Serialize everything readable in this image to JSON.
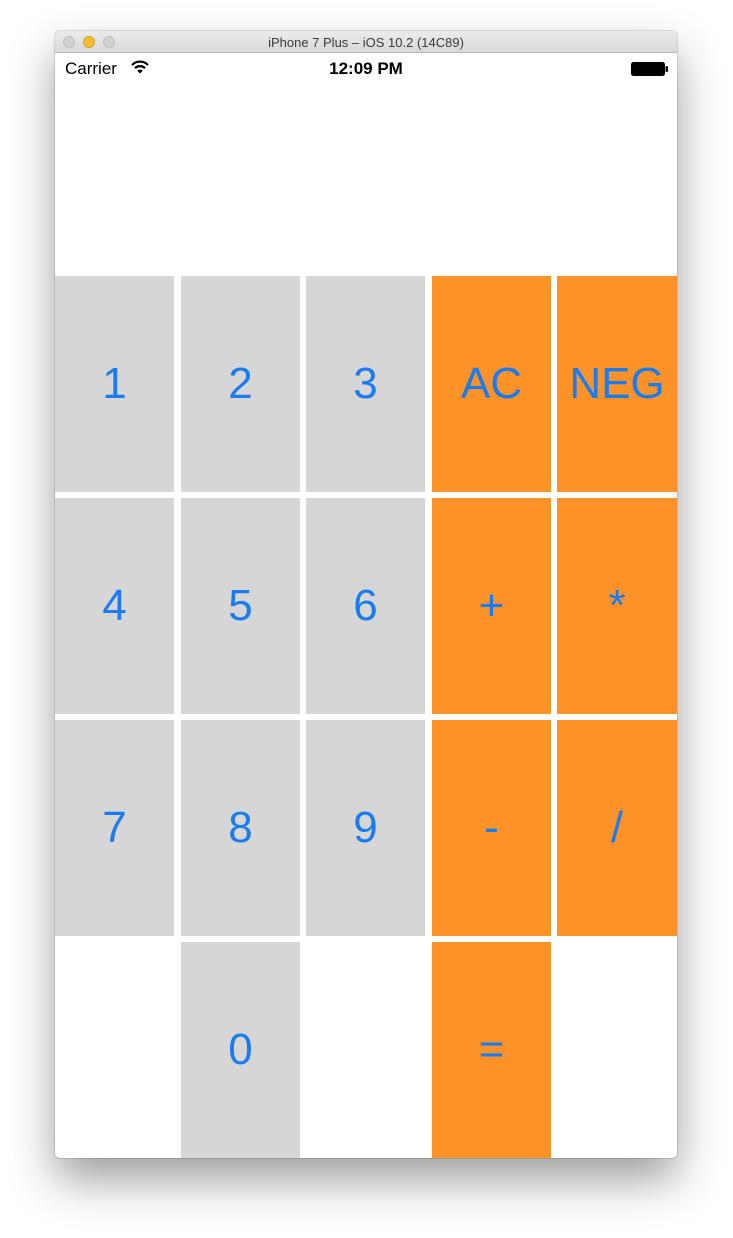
{
  "window": {
    "title": "iPhone 7 Plus – iOS 10.2 (14C89)"
  },
  "status_bar": {
    "carrier": "Carrier",
    "time": "12:09 PM",
    "wifi_icon": "wifi-icon",
    "battery_icon": "battery-icon"
  },
  "display": {
    "value": ""
  },
  "keypad": {
    "row1": [
      "1",
      "2",
      "3",
      "AC",
      "NEG"
    ],
    "row2": [
      "4",
      "5",
      "6",
      "+",
      "*"
    ],
    "row3": [
      "7",
      "8",
      "9",
      "-",
      "/"
    ],
    "row4": [
      "0",
      "="
    ]
  },
  "colors": {
    "digit_key_bg": "#d6d6d6",
    "operator_key_bg": "#fc9228",
    "key_text": "#1a7cf0"
  }
}
